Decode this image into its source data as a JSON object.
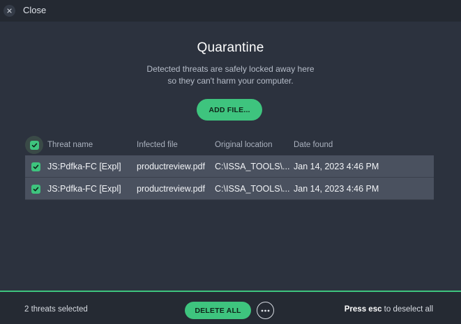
{
  "titlebar": {
    "close_label": "Close"
  },
  "main": {
    "title": "Quarantine",
    "subtitle_line1": "Detected threats are safely locked away here",
    "subtitle_line2": "so they can't harm your computer.",
    "add_file_label": "ADD FILE..."
  },
  "table": {
    "headers": [
      "Threat name",
      "Infected file",
      "Original location",
      "Date found"
    ],
    "select_all_checked": true,
    "rows": [
      {
        "threat": "JS:Pdfka-FC [Expl]",
        "file": "productreview.pdf",
        "location": "C:\\ISSA_TOOLS\\...",
        "date": "Jan 14, 2023 4:46 PM",
        "checked": true
      },
      {
        "threat": "JS:Pdfka-FC [Expl]",
        "file": "productreview.pdf",
        "location": "C:\\ISSA_TOOLS\\...",
        "date": "Jan 14, 2023 4:46 PM",
        "checked": true
      }
    ]
  },
  "footer": {
    "selected_count": "2 threats selected",
    "delete_all_label": "DELETE ALL",
    "hint_key": "Press esc",
    "hint_rest": " to deselect all"
  },
  "colors": {
    "accent": "#3ec47e",
    "background": "#2c323e",
    "row": "#4a515f"
  },
  "icons": {
    "close": "close-icon",
    "check": "checkmark-icon",
    "more": "more-horizontal-icon"
  }
}
